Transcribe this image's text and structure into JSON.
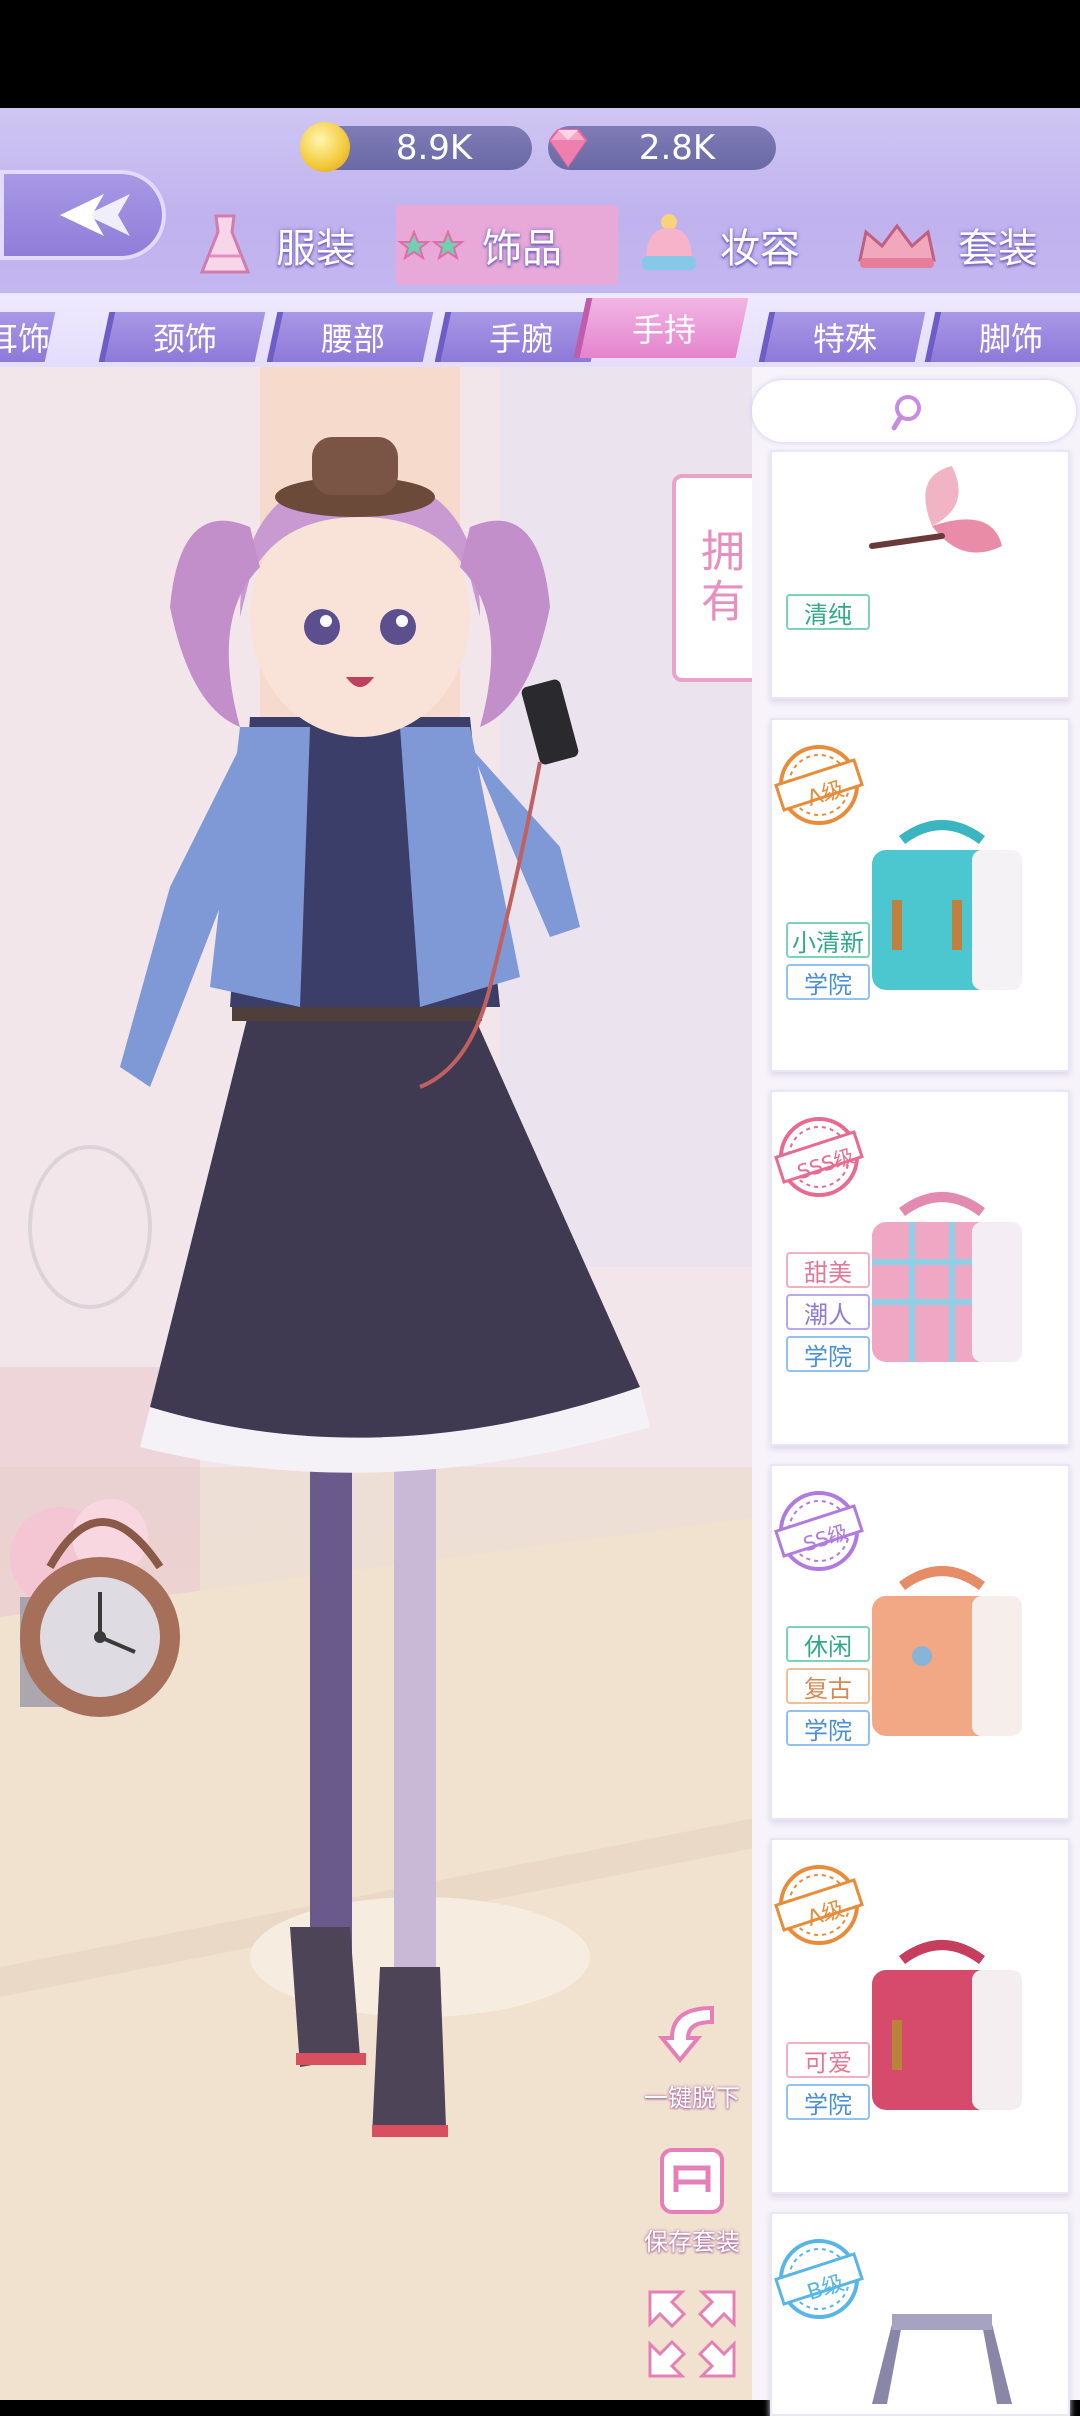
{
  "currency": {
    "gold": {
      "icon": "gold-coin-icon",
      "amount": "8.9K"
    },
    "diamond": {
      "icon": "pink-diamond-icon",
      "amount": "2.8K"
    }
  },
  "categories": [
    {
      "label": "服装",
      "icon": "dress-icon",
      "active": false
    },
    {
      "label": "饰品",
      "icon": "star-glasses-icon",
      "active": true
    },
    {
      "label": "妆容",
      "icon": "beanie-hat-icon",
      "active": false
    },
    {
      "label": "套装",
      "icon": "crown-icon",
      "active": false
    }
  ],
  "subtabs": [
    "耳饰",
    "颈饰",
    "腰部",
    "手腕",
    "手持",
    "特殊",
    "脚饰"
  ],
  "active_subtab": "手持",
  "owned_label": "拥有",
  "items": [
    {
      "grade": "",
      "tags": [
        "清纯"
      ],
      "image": "butterfly-icon"
    },
    {
      "grade": "A级",
      "tags": [
        "小清新",
        "学院"
      ],
      "image": "teal-satchel-icon"
    },
    {
      "grade": "SSS级",
      "tags": [
        "甜美",
        "潮人",
        "学院"
      ],
      "image": "pink-plaid-satchel-icon"
    },
    {
      "grade": "SS级",
      "tags": [
        "休闲",
        "复古",
        "学院"
      ],
      "image": "orange-satchel-icon"
    },
    {
      "grade": "A级",
      "tags": [
        "可爱",
        "学院"
      ],
      "image": "red-satchel-icon"
    },
    {
      "grade": "B级",
      "tags": [],
      "image": "backpack-icon"
    }
  ],
  "tools": {
    "undress": "一键脱下",
    "save_outfit": "保存套装"
  },
  "colors": {
    "header": "#c4b6f0",
    "active_tab": "#e484cd",
    "subtab": "#8d79d9",
    "grade_A": "#e98c3a",
    "grade_SSS": "#e86a8e",
    "grade_SS": "#b07ae0",
    "grade_B": "#58b6e6"
  }
}
